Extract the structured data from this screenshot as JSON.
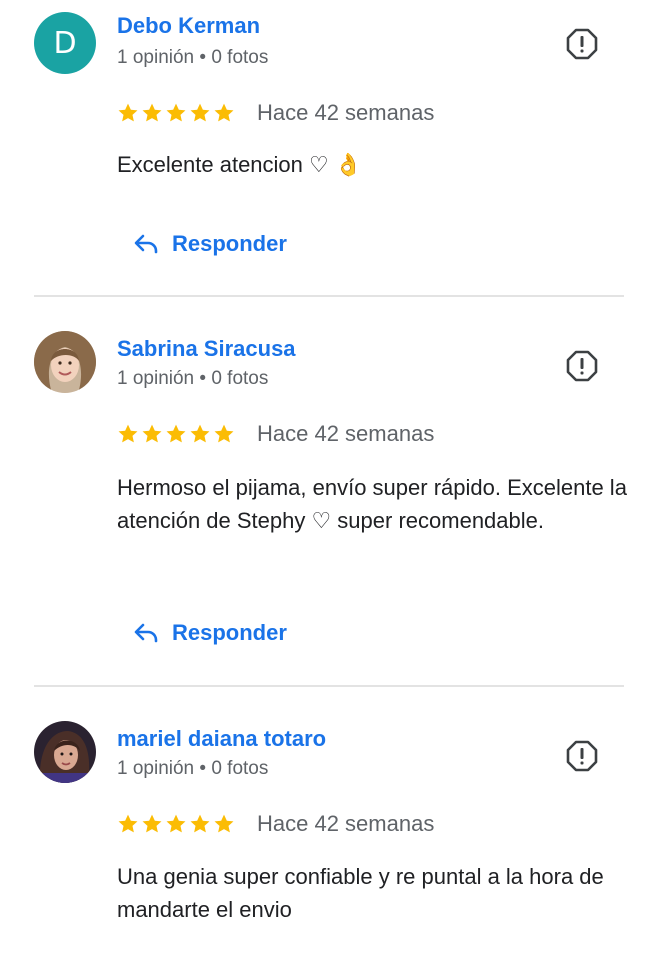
{
  "reviews": [
    {
      "avatar_letter": "D",
      "author": "Debo Kerman",
      "meta": "1 opinión • 0 fotos",
      "rating": 5,
      "time": "Hace 42 semanas",
      "text": "Excelente atencion ♡ 👌",
      "reply_label": "Responder"
    },
    {
      "author": "Sabrina Siracusa",
      "meta": "1 opinión • 0 fotos",
      "rating": 5,
      "time": "Hace 42 semanas",
      "text": "Hermoso el pijama, envío super rápido. Excelente la atención de Stephy ♡ super recomendable.",
      "reply_label": "Responder"
    },
    {
      "author": "mariel daiana totaro",
      "meta": "1 opinión • 0 fotos",
      "rating": 5,
      "time": "Hace 42 semanas",
      "text": "Una genia super confiable y re puntal a la hora de mandarte el envio"
    }
  ],
  "colors": {
    "link": "#1a73e8",
    "star": "#fbbc04",
    "avatar_d": "#1aa3a3"
  },
  "icons": [
    "report-icon",
    "star-icon",
    "reply-arrow-icon"
  ]
}
